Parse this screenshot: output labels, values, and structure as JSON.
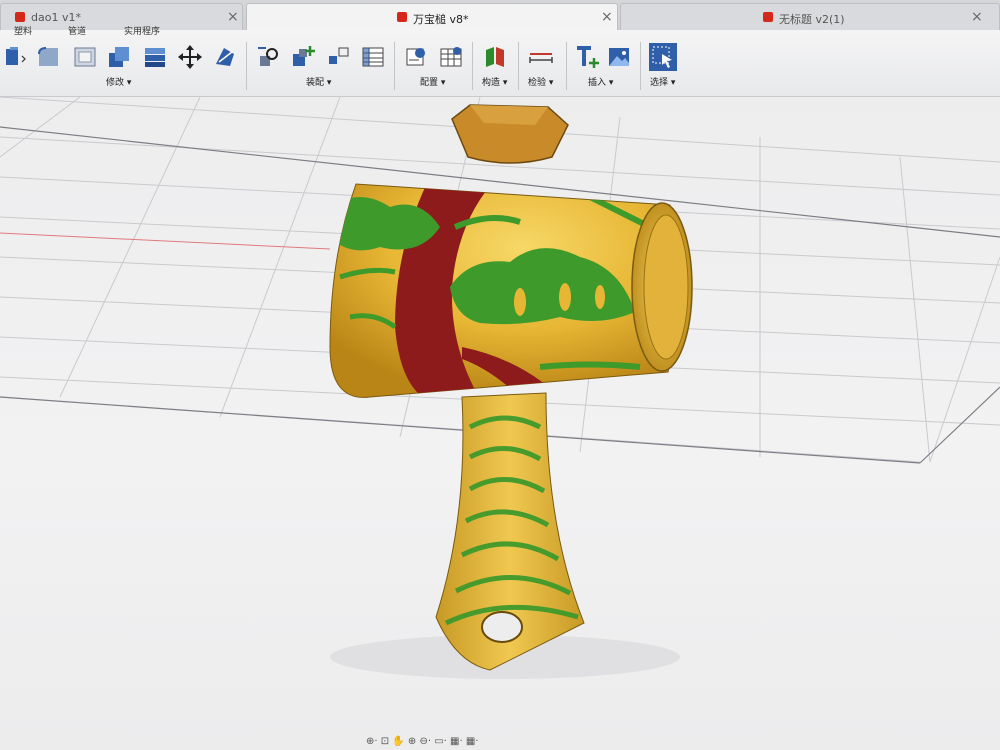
{
  "tabs": [
    {
      "label": "dao1 v1*",
      "close": "×"
    },
    {
      "label": "万宝槌 v8*",
      "close": "×"
    },
    {
      "label": "无标题 v2(1)",
      "close": "×"
    }
  ],
  "ribbon": {
    "top_labels": [
      "塑料",
      "管道",
      "实用程序"
    ],
    "groups": [
      "修改 ▾",
      "装配 ▾",
      "配置 ▾",
      "构造 ▾",
      "检验 ▾",
      "插入 ▾",
      "选择 ▾"
    ]
  },
  "bottom_toolbar": {
    "glyphs": "⊕· ⊡ ✋ ⊕ ⊖· ▭· ▦· ▦·"
  },
  "icons": [
    "red-cube-icon",
    "close-icon",
    "extrude-icon",
    "fillet-icon",
    "shell-icon",
    "combine-icon",
    "stack-icon",
    "move-icon",
    "split-icon",
    "joint-icon",
    "new-component-icon",
    "rigid-group-icon",
    "table-icon",
    "configure-icon",
    "plane-icon",
    "measure-icon",
    "insert-icon",
    "image-icon",
    "select-icon"
  ],
  "colors": {
    "accent_blue": "#2f5fa8",
    "model_yellow": "#e8b93a",
    "model_green": "#3f9a2c",
    "model_red": "#8e1b1b"
  }
}
